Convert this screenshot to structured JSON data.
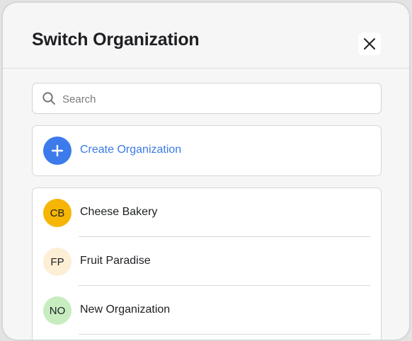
{
  "dialog": {
    "title": "Switch Organization",
    "close_icon": "close-icon"
  },
  "search": {
    "placeholder": "Search",
    "value": "",
    "icon": "search-icon"
  },
  "create": {
    "label": "Create Organization",
    "icon": "plus-icon",
    "accent_color": "#3d7bec"
  },
  "organizations": [
    {
      "initials": "CB",
      "name": "Cheese Bakery",
      "avatar_color": "#f6b606"
    },
    {
      "initials": "FP",
      "name": "Fruit Paradise",
      "avatar_color": "#fdeed6"
    },
    {
      "initials": "NO",
      "name": "New Organization",
      "avatar_color": "#c7ecc0"
    }
  ]
}
